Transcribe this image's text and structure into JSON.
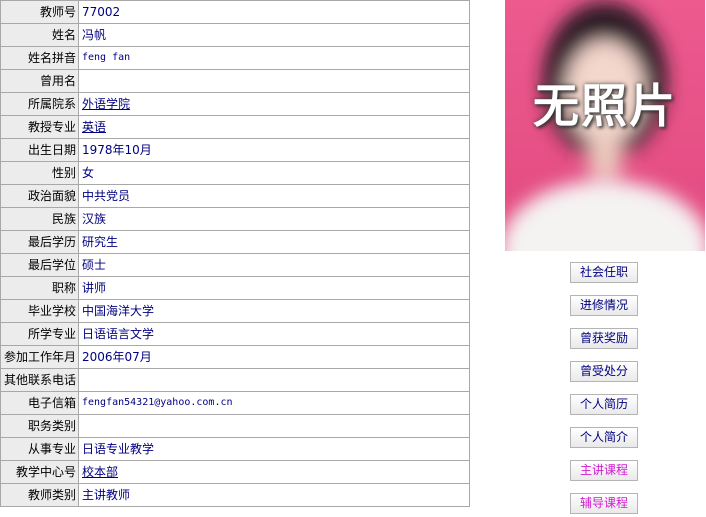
{
  "profile": {
    "rows": [
      {
        "label": "教师号",
        "value": "77002"
      },
      {
        "label": "姓名",
        "value": "冯帆"
      },
      {
        "label": "姓名拼音",
        "value": "feng fan"
      },
      {
        "label": "曾用名",
        "value": ""
      },
      {
        "label": "所属院系",
        "value": "外语学院"
      },
      {
        "label": "教授专业",
        "value": "英语"
      },
      {
        "label": "出生日期",
        "value": "1978年10月"
      },
      {
        "label": "性别",
        "value": "女"
      },
      {
        "label": "政治面貌",
        "value": "中共党员"
      },
      {
        "label": "民族",
        "value": "汉族"
      },
      {
        "label": "最后学历",
        "value": "研究生"
      },
      {
        "label": "最后学位",
        "value": "硕士"
      },
      {
        "label": "职称",
        "value": "讲师"
      },
      {
        "label": "毕业学校",
        "value": "中国海洋大学"
      },
      {
        "label": "所学专业",
        "value": "日语语言文学"
      },
      {
        "label": "参加工作年月",
        "value": "2006年07月"
      },
      {
        "label": "其他联系电话",
        "value": ""
      },
      {
        "label": "电子信箱",
        "value": "fengfan54321@yahoo.com.cn"
      },
      {
        "label": "职务类别",
        "value": ""
      },
      {
        "label": "从事专业",
        "value": "日语专业教学"
      },
      {
        "label": "教学中心号",
        "value": "校本部"
      },
      {
        "label": "教师类别",
        "value": "主讲教师"
      }
    ]
  },
  "photo": {
    "caption": "无照片",
    "background_color": "#e8568a"
  },
  "side_buttons": [
    {
      "label": "社会任职",
      "color": "#000080"
    },
    {
      "label": "进修情况",
      "color": "#000080"
    },
    {
      "label": "曾获奖励",
      "color": "#000080"
    },
    {
      "label": "曾受处分",
      "color": "#000080"
    },
    {
      "label": "个人简历",
      "color": "#000080"
    },
    {
      "label": "个人简介",
      "color": "#000080"
    },
    {
      "label": "主讲课程",
      "color": "#d11bd1"
    },
    {
      "label": "辅导课程",
      "color": "#d11bd1"
    }
  ]
}
